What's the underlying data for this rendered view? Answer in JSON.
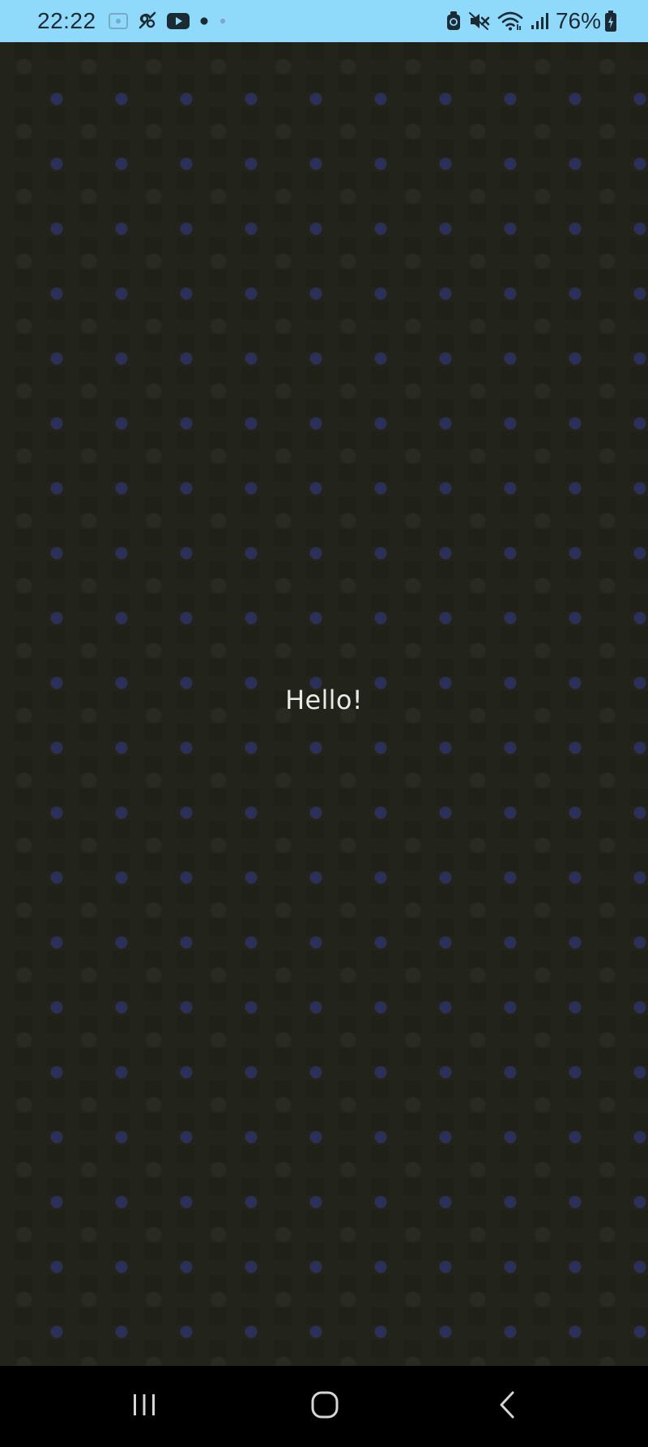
{
  "status_bar": {
    "time": "22:22",
    "battery_percent": "76%",
    "left_icons": [
      "screenshot-icon",
      "link-icon",
      "youtube-icon",
      "dot-icon",
      "small-dot-icon"
    ],
    "right_icons": [
      "alarm-icon",
      "mute-icon",
      "wifi-icon",
      "signal-icon",
      "battery-charging-icon"
    ],
    "background_color": "#8fd9fb"
  },
  "content": {
    "message": "Hello!",
    "background_color": "#1f2018",
    "text_color": "#e8e8e4"
  },
  "nav_bar": {
    "buttons": [
      "recents-icon",
      "home-icon",
      "back-icon"
    ],
    "background_color": "#000000"
  }
}
